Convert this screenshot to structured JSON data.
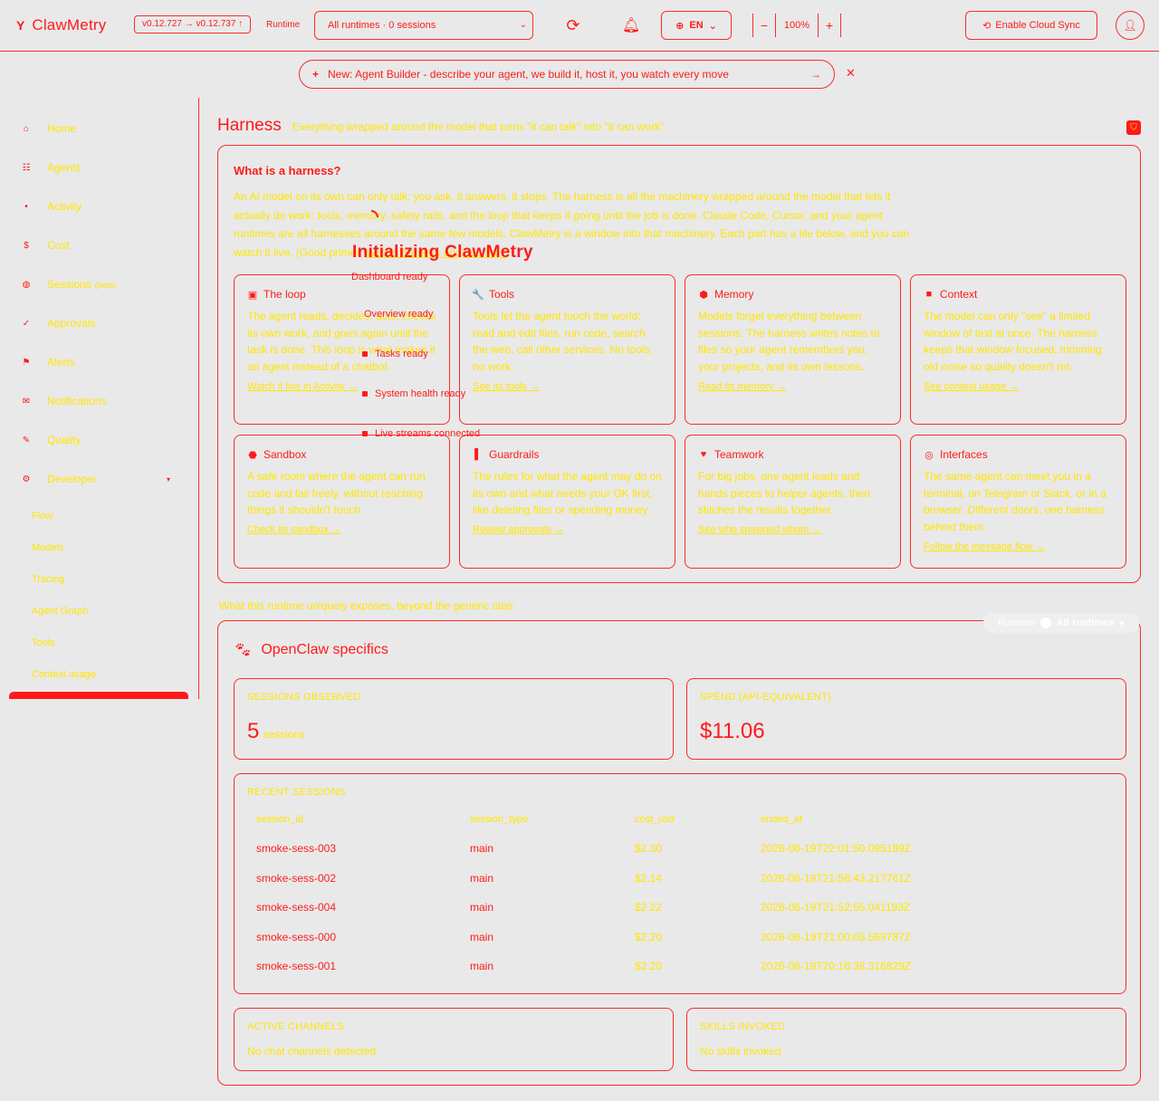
{
  "header": {
    "app_name": "ClawMetry",
    "version": "v0.12.727 → v0.12.737 ↑",
    "runtime_label": "Runtime",
    "runtime_value": "All runtimes · 0 sessions",
    "language": "EN",
    "zoom_minus": "−",
    "zoom_level": "100%",
    "zoom_plus": "+",
    "cloud_sync": "Enable Cloud Sync"
  },
  "banner": {
    "plus": "+",
    "text": "New: Agent Builder - describe your agent, we build it, host it, you watch every move",
    "arrow": "→",
    "close": "✕"
  },
  "sidebar": {
    "items": [
      {
        "label": "Home",
        "icon": "home-icon",
        "glyph": "⌂"
      },
      {
        "label": "Agents",
        "icon": "grid-icon",
        "glyph": "☷"
      },
      {
        "label": "Activity",
        "icon": "dot-icon",
        "glyph": "•"
      },
      {
        "label": "Cost",
        "icon": "dollar-icon",
        "glyph": "$"
      },
      {
        "label": "Sessions",
        "badge": "(beta)",
        "icon": "sessions-icon",
        "glyph": "◍"
      },
      {
        "label": "Approvals",
        "icon": "check-icon",
        "glyph": "✓"
      },
      {
        "label": "Alerts",
        "icon": "flag-icon",
        "glyph": "⚑"
      },
      {
        "label": "Notifications",
        "icon": "mail-icon",
        "glyph": "✉"
      },
      {
        "label": "Quality",
        "icon": "quality-icon",
        "glyph": "✎"
      },
      {
        "label": "Developer",
        "icon": "gear-icon",
        "glyph": "⚙"
      }
    ],
    "developer_chevron": "▾",
    "sub_items": [
      "Flow",
      "Models",
      "Tracing",
      "Agent Graph",
      "Tools",
      "Context usage"
    ]
  },
  "main": {
    "title": "Harness",
    "subtitle": "Everything wrapped around the model that turns \"it can talk\" into \"it can work\".",
    "what_title": "What is a harness?",
    "what_body": "An AI model on its own can only talk: you ask, it answers, it stops. The harness is all the machinery wrapped around the model that lets it actually do work: tools, memory, safety rails, and the loop that keeps it going until the job is done. Claude Code, Cursor, and your agent runtimes are all harnesses around the same few models. ClawMetry is a window into that machinery. Each part has a tile below, and you can watch it live. (Good primer: ",
    "primer_link": "What's harness engineering?",
    "primer_end": ")",
    "cards": [
      {
        "title": "The loop",
        "icon": "loop-icon",
        "glyph": "▣",
        "body": "The agent reads, decides, acts, checks its own work, and goes again until the task is done. This loop is what makes it an agent instead of a chatbot.",
        "link": "Watch it live in Activity →"
      },
      {
        "title": "Tools",
        "icon": "wrench-icon",
        "glyph": "🔧",
        "body": "Tools let the agent touch the world: read and edit files, run code, search the web, call other services. No tools, no work.",
        "link": "See its tools →"
      },
      {
        "title": "Memory",
        "icon": "memory-icon",
        "glyph": "⬢",
        "body": "Models forget everything between sessions. The harness writes notes to files so your agent remembers you, your projects, and its own lessons.",
        "link": "Read its memory →"
      },
      {
        "title": "Context",
        "icon": "context-icon",
        "glyph": "■",
        "body": "The model can only \"see\" a limited window of text at once. The harness keeps that window focused, trimming old noise so quality doesn't rot.",
        "link": "See context usage →"
      },
      {
        "title": "Sandbox",
        "icon": "sandbox-icon",
        "glyph": "⬣",
        "body": "A safe room where the agent can run code and fail freely, without reaching things it shouldn't touch.",
        "link": "Check its sandbox →"
      },
      {
        "title": "Guardrails",
        "icon": "guardrail-icon",
        "glyph": "▌",
        "body": "The rules for what the agent may do on its own and what needs your OK first, like deleting files or spending money.",
        "link": "Review approvals →"
      },
      {
        "title": "Teamwork",
        "icon": "heart-icon",
        "glyph": "♥",
        "body": "For big jobs, one agent leads and hands pieces to helper agents, then stitches the results together.",
        "link": "See who spawned whom →"
      },
      {
        "title": "Interfaces",
        "icon": "chat-icon",
        "glyph": "◎",
        "body": "The same agent can meet you in a terminal, on Telegram or Slack, or in a browser. Different doors, one harness behind them.",
        "link": "Follow the message flow →"
      }
    ],
    "init": {
      "title": "Initializing ClawMetry",
      "steps": [
        "Dashboard ready",
        "Overview ready",
        "Tasks ready",
        "System health ready",
        "Live streams connected"
      ]
    },
    "runtime_note": "What this runtime uniquely exposes, beyond the generic tabs:",
    "runtime_filter_label": "Runtime",
    "runtime_filter_value": "All runtimes",
    "runtime_filter_chevron": "▾"
  },
  "openclaw": {
    "title": "OpenClaw specifics",
    "sessions_label": "SESSIONS OBSERVED",
    "sessions_value": "5",
    "sessions_unit": "sessions",
    "spend_label": "SPEND (API-EQUIVALENT)",
    "spend_value": "$11.06",
    "recent_label": "RECENT SESSIONS",
    "columns": [
      "session_id",
      "session_type",
      "cost_usd",
      "ended_at"
    ],
    "rows": [
      [
        "smoke-sess-003",
        "main",
        "$2.30",
        "2026-06-19T22:01:50.095189Z"
      ],
      [
        "smoke-sess-002",
        "main",
        "$2.14",
        "2026-06-19T21:56:43.217761Z"
      ],
      [
        "smoke-sess-004",
        "main",
        "$2.22",
        "2026-06-19T21:52:55.041193Z"
      ],
      [
        "smoke-sess-000",
        "main",
        "$2.20",
        "2026-06-19T21:00:05.569787Z"
      ],
      [
        "smoke-sess-001",
        "main",
        "$2.20",
        "2026-06-19T20:16:38.316829Z"
      ]
    ],
    "channels_label": "ACTIVE CHANNELS",
    "channels_value": "No chat channels detected",
    "skills_label": "SKILLS INVOKED",
    "skills_value": "No skills invoked"
  }
}
